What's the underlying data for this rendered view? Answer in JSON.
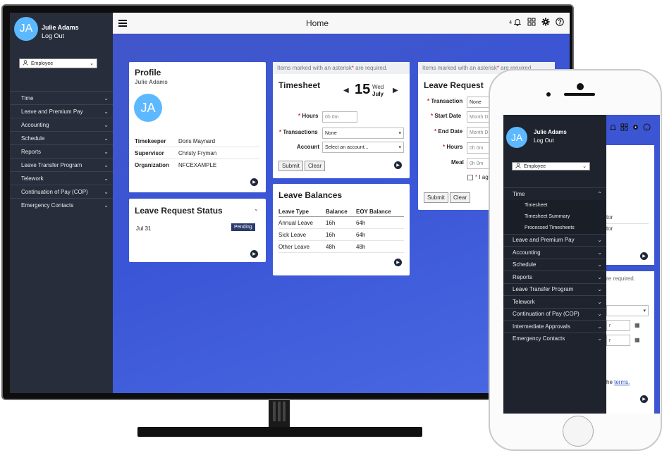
{
  "user": {
    "initials": "JA",
    "name": "Julie Adams",
    "logout": "Log Out"
  },
  "role": {
    "selected": "Employee"
  },
  "nav": [
    "Time",
    "Leave and Premium Pay",
    "Accounting",
    "Schedule",
    "Reports",
    "Leave Transfer Program",
    "Telework",
    "Continuation of Pay (COP)",
    "Emergency Contacts"
  ],
  "header": {
    "title": "Home",
    "notification_count": "4"
  },
  "profile": {
    "title": "Profile",
    "name": "Julie Adams",
    "rows": [
      {
        "label": "Timekeeper",
        "value": "Doris Maynard"
      },
      {
        "label": "Supervisor",
        "value": "Christy Fryman"
      },
      {
        "label": "Organization",
        "value": "NFCEXAMPLE"
      }
    ]
  },
  "leave_status": {
    "title": "Leave Request Status",
    "date": "Jul 31",
    "status": "Pending"
  },
  "required_note": {
    "before": "Items marked with an asterisk",
    "star": "*",
    "after": " are required."
  },
  "timesheet": {
    "title": "Timesheet",
    "day": "15",
    "weekday": "Wed",
    "month": "July",
    "hours_label": "Hours",
    "hours_placeholder": "0h 0m",
    "transactions_label": "Transactions",
    "transactions_value": "None",
    "account_label": "Account",
    "account_placeholder": "Select an account...",
    "submit": "Submit",
    "clear": "Clear"
  },
  "leave_balances": {
    "title": "Leave Balances",
    "headers": [
      "Leave Type",
      "Balance",
      "EOY Balance"
    ],
    "rows": [
      [
        "Annual Leave",
        "16h",
        "64h"
      ],
      [
        "Sick Leave",
        "16h",
        "64h"
      ],
      [
        "Other Leave",
        "48h",
        "48h"
      ]
    ]
  },
  "leave_request": {
    "title": "Leave Request",
    "transaction_label": "Transaction",
    "transaction_value": "None",
    "start_label": "Start Date",
    "start_placeholder": "Month D",
    "end_label": "End Date",
    "end_placeholder": "Month D",
    "hours_label": "Hours",
    "hours_placeholder": "0h 0m",
    "meal_label": "Meal",
    "meal_placeholder": "0h 0m",
    "agree_text": "I agr",
    "submit": "Submit",
    "clear": "Clear"
  },
  "mobile": {
    "nav_expanded": "Time",
    "sub_items": [
      "Timesheet",
      "Timesheet Summary",
      "Processed Timesheets"
    ],
    "nav_rest": [
      "Leave and Premium Pay",
      "Accounting",
      "Schedule",
      "Reports",
      "Leave Transfer Program",
      "Telework",
      "Continuation of Pay (COP)",
      "Intermediate Approvals",
      "Emergency Contacts"
    ],
    "peek_tor1": "tor",
    "peek_tor2": "tor",
    "peek_required": "re required.",
    "peek_r1": "r",
    "peek_r2": "r",
    "peek_terms_prefix": "he ",
    "peek_terms": "terms."
  }
}
